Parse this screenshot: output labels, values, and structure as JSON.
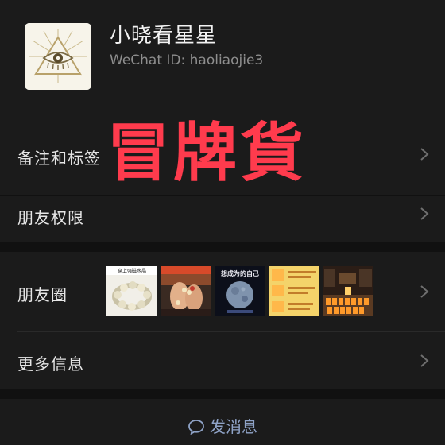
{
  "profile": {
    "name": "小晓看星星",
    "wechat_id": "WeChat ID: haoliaojie3",
    "avatar_icon": "eye-in-triangle-icon"
  },
  "rows": {
    "remarks": "备注和标签",
    "permissions": "朋友权限",
    "moments": "朋友圈",
    "more_info": "更多信息"
  },
  "moments_thumbs": [
    {
      "caption": "穿上强磁水晶",
      "theme": "crystal-bracelet"
    },
    {
      "caption": "",
      "theme": "hands-bracelets"
    },
    {
      "caption": "想成为的自己",
      "theme": "moon-night"
    },
    {
      "caption": "",
      "theme": "yellow-notes"
    },
    {
      "caption": "",
      "theme": "temple-candles"
    }
  ],
  "send_message": {
    "label": "发消息",
    "icon": "chat-bubble-icon"
  },
  "overlay_text": "冒牌貨",
  "colors": {
    "background": "#111111",
    "panel": "#1b1b1b",
    "text": "#e6e6e6",
    "muted": "#8e8e8e",
    "link": "#8fa3c7",
    "overlay": "#ff3b4d"
  }
}
